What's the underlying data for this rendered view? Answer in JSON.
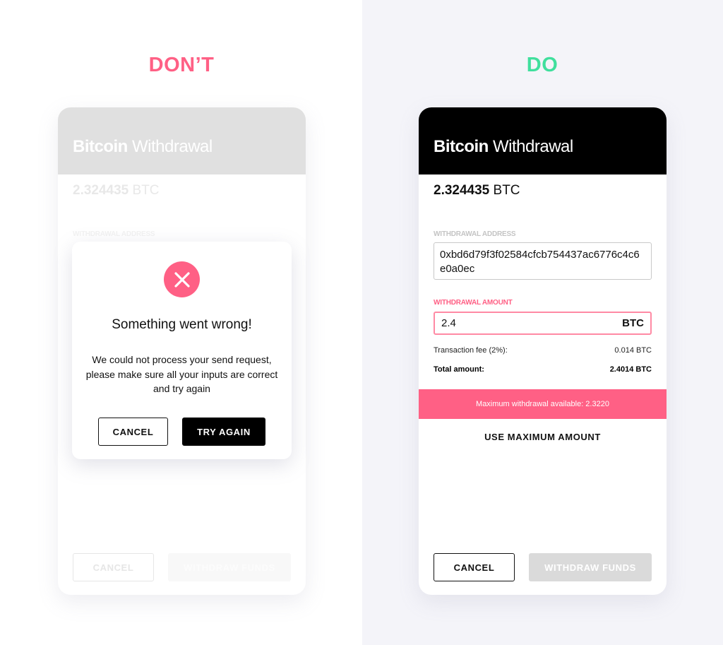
{
  "colors": {
    "dont": "#ff6085",
    "do": "#40df9d",
    "error": "#ff6085",
    "header_active": "#000000",
    "header_disabled": "#e0e0e0",
    "right_background": "#f4f4f9"
  },
  "headings": {
    "dont": "DON’T",
    "do": "DO"
  },
  "dont_panel": {
    "header": {
      "title_bold": "Bitcoin",
      "title_light": "Withdrawal"
    },
    "balance": {
      "amount": "2.324435",
      "unit": "BTC"
    },
    "address_label": "WITHDRAWAL ADDRESS",
    "buttons": {
      "cancel": "CANCEL",
      "withdraw": "WITHDRAW FUNDS"
    },
    "modal": {
      "icon": "close-icon",
      "title": "Something went wrong!",
      "body": "We could not process your send request, please make sure all your inputs are correct and try again",
      "cancel": "CANCEL",
      "retry": "TRY AGAIN"
    }
  },
  "do_panel": {
    "header": {
      "title_bold": "Bitcoin",
      "title_light": "Withdrawal"
    },
    "balance": {
      "amount": "2.324435",
      "unit": "BTC"
    },
    "address_label": "WITHDRAWAL ADDRESS",
    "address_value": "0xbd6d79f3f02584cfcb754437ac6776c4c6e0a0ec",
    "amount_label": "WITHDRAWAL AMOUNT",
    "amount_value": "2.4",
    "amount_unit": "BTC",
    "fee_label": "Transaction fee (2%):",
    "fee_value": "0.014 BTC",
    "total_label": "Total amount:",
    "total_value": "2.4014 BTC",
    "warning": "Maximum withdrawal available: 2.3220",
    "use_max": "USE MAXIMUM AMOUNT",
    "buttons": {
      "cancel": "CANCEL",
      "withdraw": "WITHDRAW FUNDS"
    }
  }
}
